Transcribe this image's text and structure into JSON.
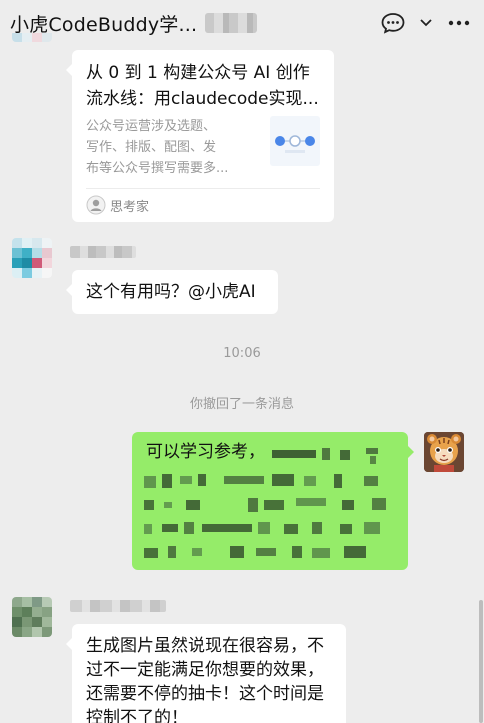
{
  "header": {
    "title": "小虎CodeBuddy学...",
    "chat_icon": "speech-bubble-icon",
    "dropdown_icon": "chevron-down-icon",
    "more_icon": "more-horizontal-icon"
  },
  "messages": {
    "article_card": {
      "title": "从 0 到 1 构建公众号 AI 创作流水线：用claudecode实现...",
      "title_line1": "从 0 到 1 构建公众号 AI 创作",
      "title_line2": "流水线：用claudecode实现...",
      "desc_line1": "公众号运营涉及选题、",
      "desc_line2": "写作、排版、配图、发",
      "desc_line3": "布等公众号撰写需要多...",
      "source": "思考家"
    },
    "question": {
      "text": "这个有用吗？@小虎AI"
    },
    "time_divider": "10:06",
    "recall_notice": "你撤回了一条消息",
    "my_reply": {
      "visible_prefix": "可以学习参考，"
    },
    "last_message": {
      "line1": "生成图片虽然说现在很容易，不",
      "line2": "过不一定能满足你想要的效果，",
      "line3": "还需要不停的抽卡！这个时间是",
      "line4": "控制不了的！"
    }
  },
  "colors": {
    "background": "#ededed",
    "my_bubble": "#95ec69",
    "other_bubble": "#ffffff",
    "meta_text": "#9a9a9a"
  }
}
